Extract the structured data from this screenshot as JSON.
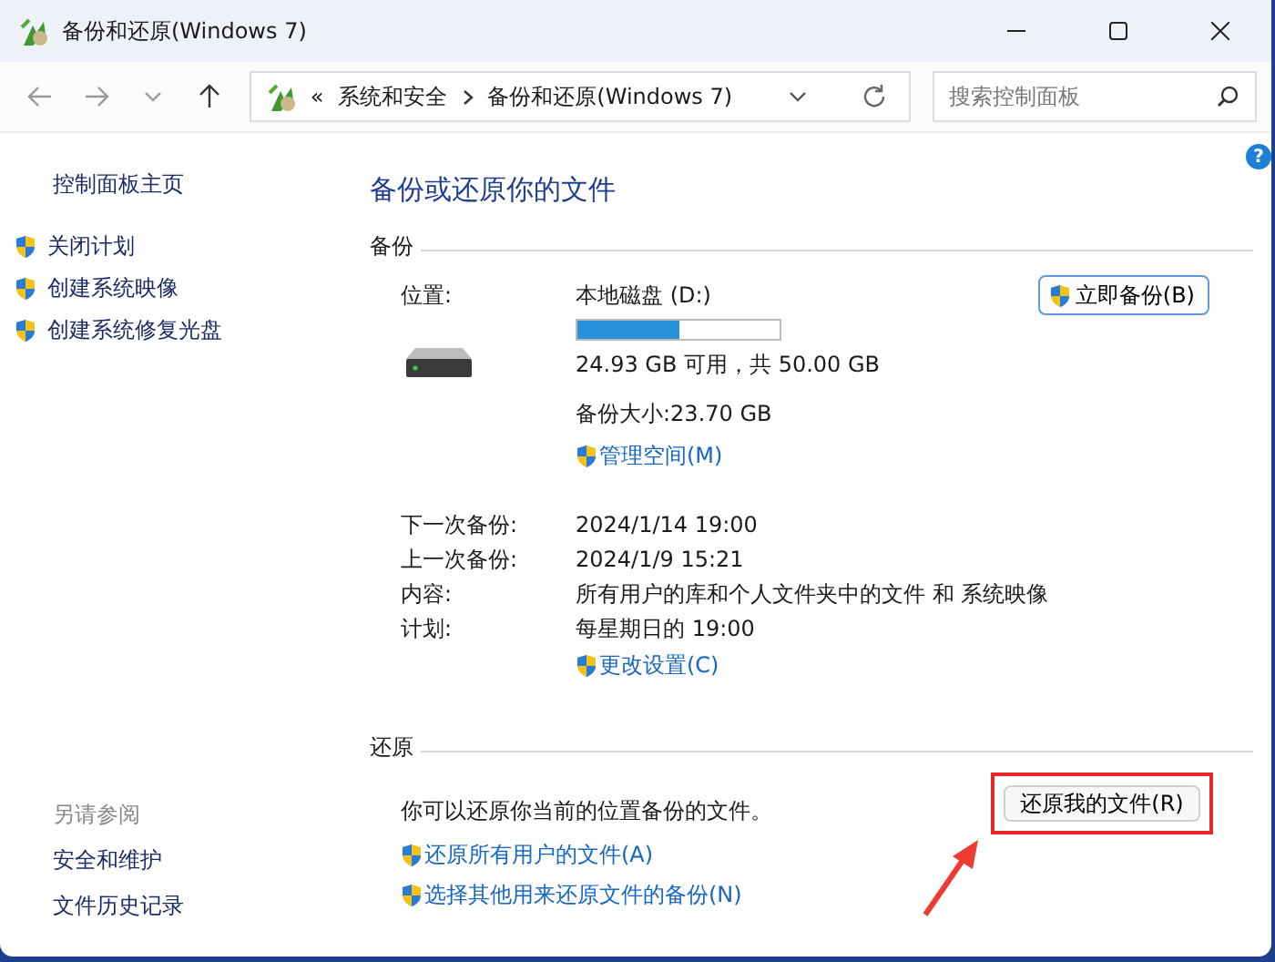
{
  "window": {
    "title": "备份和还原(Windows 7)"
  },
  "address_bar": {
    "overflow": "«",
    "crumbs": [
      "系统和安全",
      "备份和还原(Windows 7)"
    ]
  },
  "search": {
    "placeholder": "搜索控制面板"
  },
  "help": "?",
  "sidebar": {
    "home": "控制面板主页",
    "tasks": [
      "关闭计划",
      "创建系统映像",
      "创建系统修复光盘"
    ],
    "see_also": {
      "heading": "另请参阅",
      "links": [
        "安全和维护",
        "文件历史记录"
      ]
    }
  },
  "main": {
    "title": "备份或还原你的文件",
    "backup": {
      "heading": "备份",
      "location_label": "位置:",
      "drive": "本地磁盘 (D:)",
      "usage": {
        "level": 0.5
      },
      "free_space": "24.93 GB 可用，共 50.00 GB",
      "backup_size": "备份大小:23.70 GB",
      "manage_link": "管理空间(M)",
      "button": "立即备份(B)",
      "details": [
        {
          "label": "下一次备份:",
          "value": "2024/1/14 19:00"
        },
        {
          "label": "上一次备份:",
          "value": "2024/1/9 15:21"
        },
        {
          "label": "内容:",
          "value": "所有用户的库和个人文件夹中的文件 和 系统映像"
        },
        {
          "label": "计划:",
          "value": "每星期日的 19:00"
        }
      ],
      "settings_link": "更改设置(C)"
    },
    "restore": {
      "heading": "还原",
      "text": "你可以还原你当前的位置备份的文件。",
      "button": {
        "label": "还原我的文件(R)",
        "highlighted": true
      },
      "links": [
        "还原所有用户的文件(A)",
        "选择其他用来还原文件的备份(N)"
      ]
    }
  }
}
